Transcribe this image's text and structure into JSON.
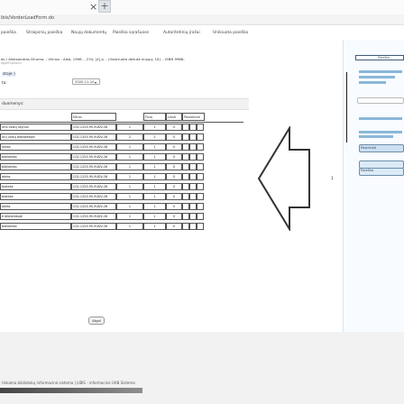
{
  "browser": {
    "tab_close": "×",
    "tab_plus": "+",
    "url": "ibis/VorderLoadForm.do"
  },
  "nav": {
    "items": [
      "paieška",
      "Straipsnių paieška",
      "Naujų dokumentų",
      "Paieška sąrašuose",
      "Autoritetinių įrašai",
      "Unikiuota paieška"
    ]
  },
  "record": {
    "citation": "as / Aleksandras Dhuma. - Vilnius : Alka, 1998. - 234, [4] p. - (Iliustruota dėžutė knygų; 10). - ISBN 9986-",
    "cite_sub": "egzempliorių",
    "label_title": "stoje )",
    "label_date": "ta:",
    "date_value": "2020-11-10",
    "dues_label": "duomenys:"
  },
  "table": {
    "headers": [
      "",
      "šifras",
      "",
      "Fizio fondas",
      "Leisti",
      "Pasiekiam"
    ],
    "rows": [
      {
        "loc": "ūrio vaikų skyrius",
        "code": "C02-1253-95-9UDV-26",
        "copies": "1",
        "count": "1",
        "mark": "O"
      },
      {
        "loc": "ūrų vaikų bibliotekoje",
        "code": "C02-1253-95-9UDV-26",
        "copies": "2",
        "count": "2",
        "mark": "O"
      },
      {
        "loc": "ūteka",
        "code": "C02-1253-95-9UDV-26",
        "copies": "1",
        "count": "1",
        "mark": "O"
      },
      {
        "loc": "biblioteka",
        "code": "C02-1253-95-9UDV-26",
        "copies": "1",
        "count": "1",
        "mark": "O"
      },
      {
        "loc": "biblioteka",
        "code": "C02-1253-95-9UDV-26",
        "copies": "1",
        "count": "1",
        "mark": "O"
      },
      {
        "loc": "oteka",
        "code": "C02-1253-95-9UDV-26",
        "copies": "1",
        "count": "1",
        "mark": "O"
      },
      {
        "loc": "bioteka",
        "code": "C02-1253-95-9UDV-26",
        "copies": "1",
        "count": "1",
        "mark": "O"
      },
      {
        "loc": "bioteka",
        "code": "C02-1253-95-9UDV-26",
        "copies": "1",
        "count": "1",
        "mark": "O"
      },
      {
        "loc": "oteka",
        "code": "C02-1253-95-9UDV-26",
        "copies": "1",
        "count": "1",
        "mark": "O"
      },
      {
        "loc": "ė bibliotekoje",
        "code": "C02-1253-95-9UDV-26",
        "copies": "1",
        "count": "1",
        "mark": "O"
      },
      {
        "loc": "biblioteka",
        "code": "C02-1253-95-9UDV-26",
        "copies": "1",
        "count": "1",
        "mark": "O"
      }
    ]
  },
  "page_indicator": "1",
  "footer_button": "Atgal",
  "footer": {
    "text": "tinkama bibliotekų informacinė sistema | LIBIS - informacinė UAB Sistema"
  },
  "sidebar": {
    "title": "Paieška",
    "lines": [
      "Nusižymėjo Naujienos",
      "Kontaktai",
      "Nuoroda į knygų sąrašą"
    ],
    "buttons": [
      "Pasirinkti",
      "Paieška"
    ],
    "extra_links": [
      "Sutartis",
      "Naudojimo taisyklės"
    ]
  }
}
